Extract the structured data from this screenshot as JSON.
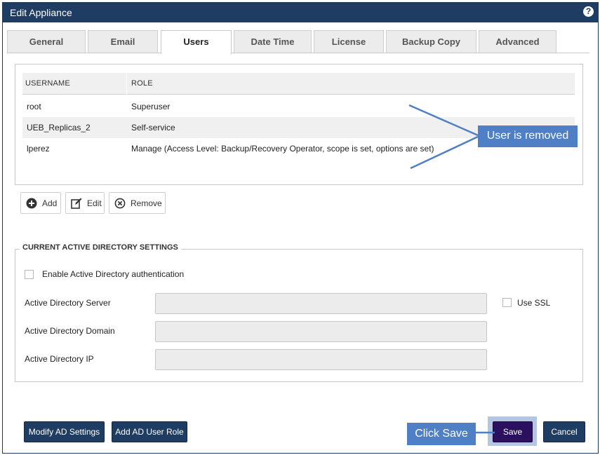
{
  "window": {
    "title": "Edit Appliance",
    "help_icon": "question-icon"
  },
  "tabs": [
    {
      "label": "General",
      "active": false
    },
    {
      "label": "Email",
      "active": false
    },
    {
      "label": "Users",
      "active": true
    },
    {
      "label": "Date Time",
      "active": false
    },
    {
      "label": "License",
      "active": false
    },
    {
      "label": "Backup Copy",
      "active": false
    },
    {
      "label": "Advanced",
      "active": false
    }
  ],
  "users_table": {
    "columns": [
      "USERNAME",
      "ROLE"
    ],
    "rows": [
      {
        "username": "root",
        "role": "Superuser"
      },
      {
        "username": "UEB_Replicas_2",
        "role": "Self-service"
      },
      {
        "username": "lperez",
        "role": "Manage (Access Level: Backup/Recovery Operator, scope is set, options are set)"
      }
    ]
  },
  "user_actions": {
    "add": {
      "label": "Add",
      "icon": "plus-circle-icon"
    },
    "edit": {
      "label": "Edit",
      "icon": "edit-icon"
    },
    "remove": {
      "label": "Remove",
      "icon": "remove-circle-icon"
    }
  },
  "ad_settings": {
    "legend": "CURRENT ACTIVE DIRECTORY SETTINGS",
    "enable_label": "Enable Active Directory authentication",
    "enable_checked": false,
    "server_label": "Active Directory Server",
    "server_value": "",
    "use_ssl_label": "Use SSL",
    "use_ssl_checked": false,
    "domain_label": "Active Directory Domain",
    "domain_value": "",
    "ip_label": "Active Directory IP",
    "ip_value": ""
  },
  "footer": {
    "modify_ad": "Modify AD Settings",
    "add_ad_role": "Add AD User Role",
    "save": "Save",
    "cancel": "Cancel"
  },
  "annotations": {
    "removed_callout": "User is removed",
    "save_callout": "Click Save"
  },
  "colors": {
    "titlebar": "#1f3d63",
    "callout": "#4f7fc4",
    "save_button": "#2b1060",
    "save_highlight": "#b4c6e4"
  }
}
